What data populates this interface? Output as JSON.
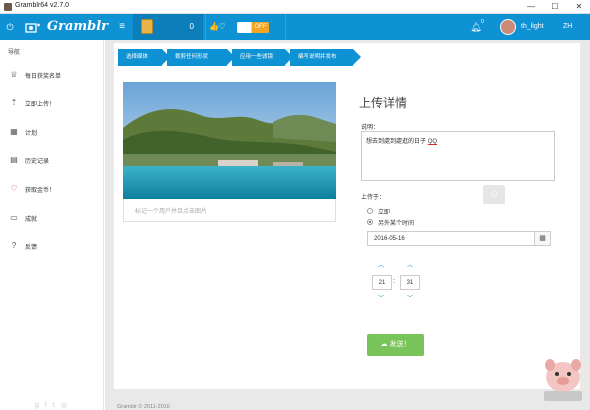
{
  "window": {
    "title": "Gramblr64 v2.7.0",
    "minimize": "—",
    "maximize": "☐",
    "close": "✕"
  },
  "appbar": {
    "logo": "Gramblr",
    "coin_count": "0",
    "toggle_label": "OFF",
    "notification_count": "0",
    "username": "th_light",
    "language": "ZH"
  },
  "sidebar": {
    "title": "导航",
    "items": [
      {
        "label": "每日获奖名单",
        "icon": "trophy-icon"
      },
      {
        "label": "立即上传！",
        "icon": "upload-icon"
      },
      {
        "label": "计划",
        "icon": "calendar-icon"
      },
      {
        "label": "历史记录",
        "icon": "history-icon"
      },
      {
        "label": "获取金币！",
        "icon": "heart-icon"
      },
      {
        "label": "成就",
        "icon": "achievement-icon"
      },
      {
        "label": "反馈",
        "icon": "help-icon"
      }
    ]
  },
  "steps": [
    "选择媒体",
    "裁剪任何形状",
    "应用一些滤镜",
    "编写说明并发布"
  ],
  "photo": {
    "caption_placeholder": "标记一个用户并且点击图片"
  },
  "form": {
    "title": "上传详情",
    "description_label": "说明：",
    "description_text_a": "想去到處到處逛的日子",
    "description_text_b": "QQ",
    "upload_label": "上传于：",
    "option_now": "立即",
    "option_other": "另外某个时间",
    "date_value": "2016-05-16",
    "hour": "21",
    "minute": "31",
    "send_label": "发送！"
  },
  "footer": {
    "copyright": "Gramblr © 2011-2016"
  },
  "colors": {
    "accent": "#0f92d4",
    "send": "#78c45a",
    "toggle_off": "#f6a521"
  }
}
